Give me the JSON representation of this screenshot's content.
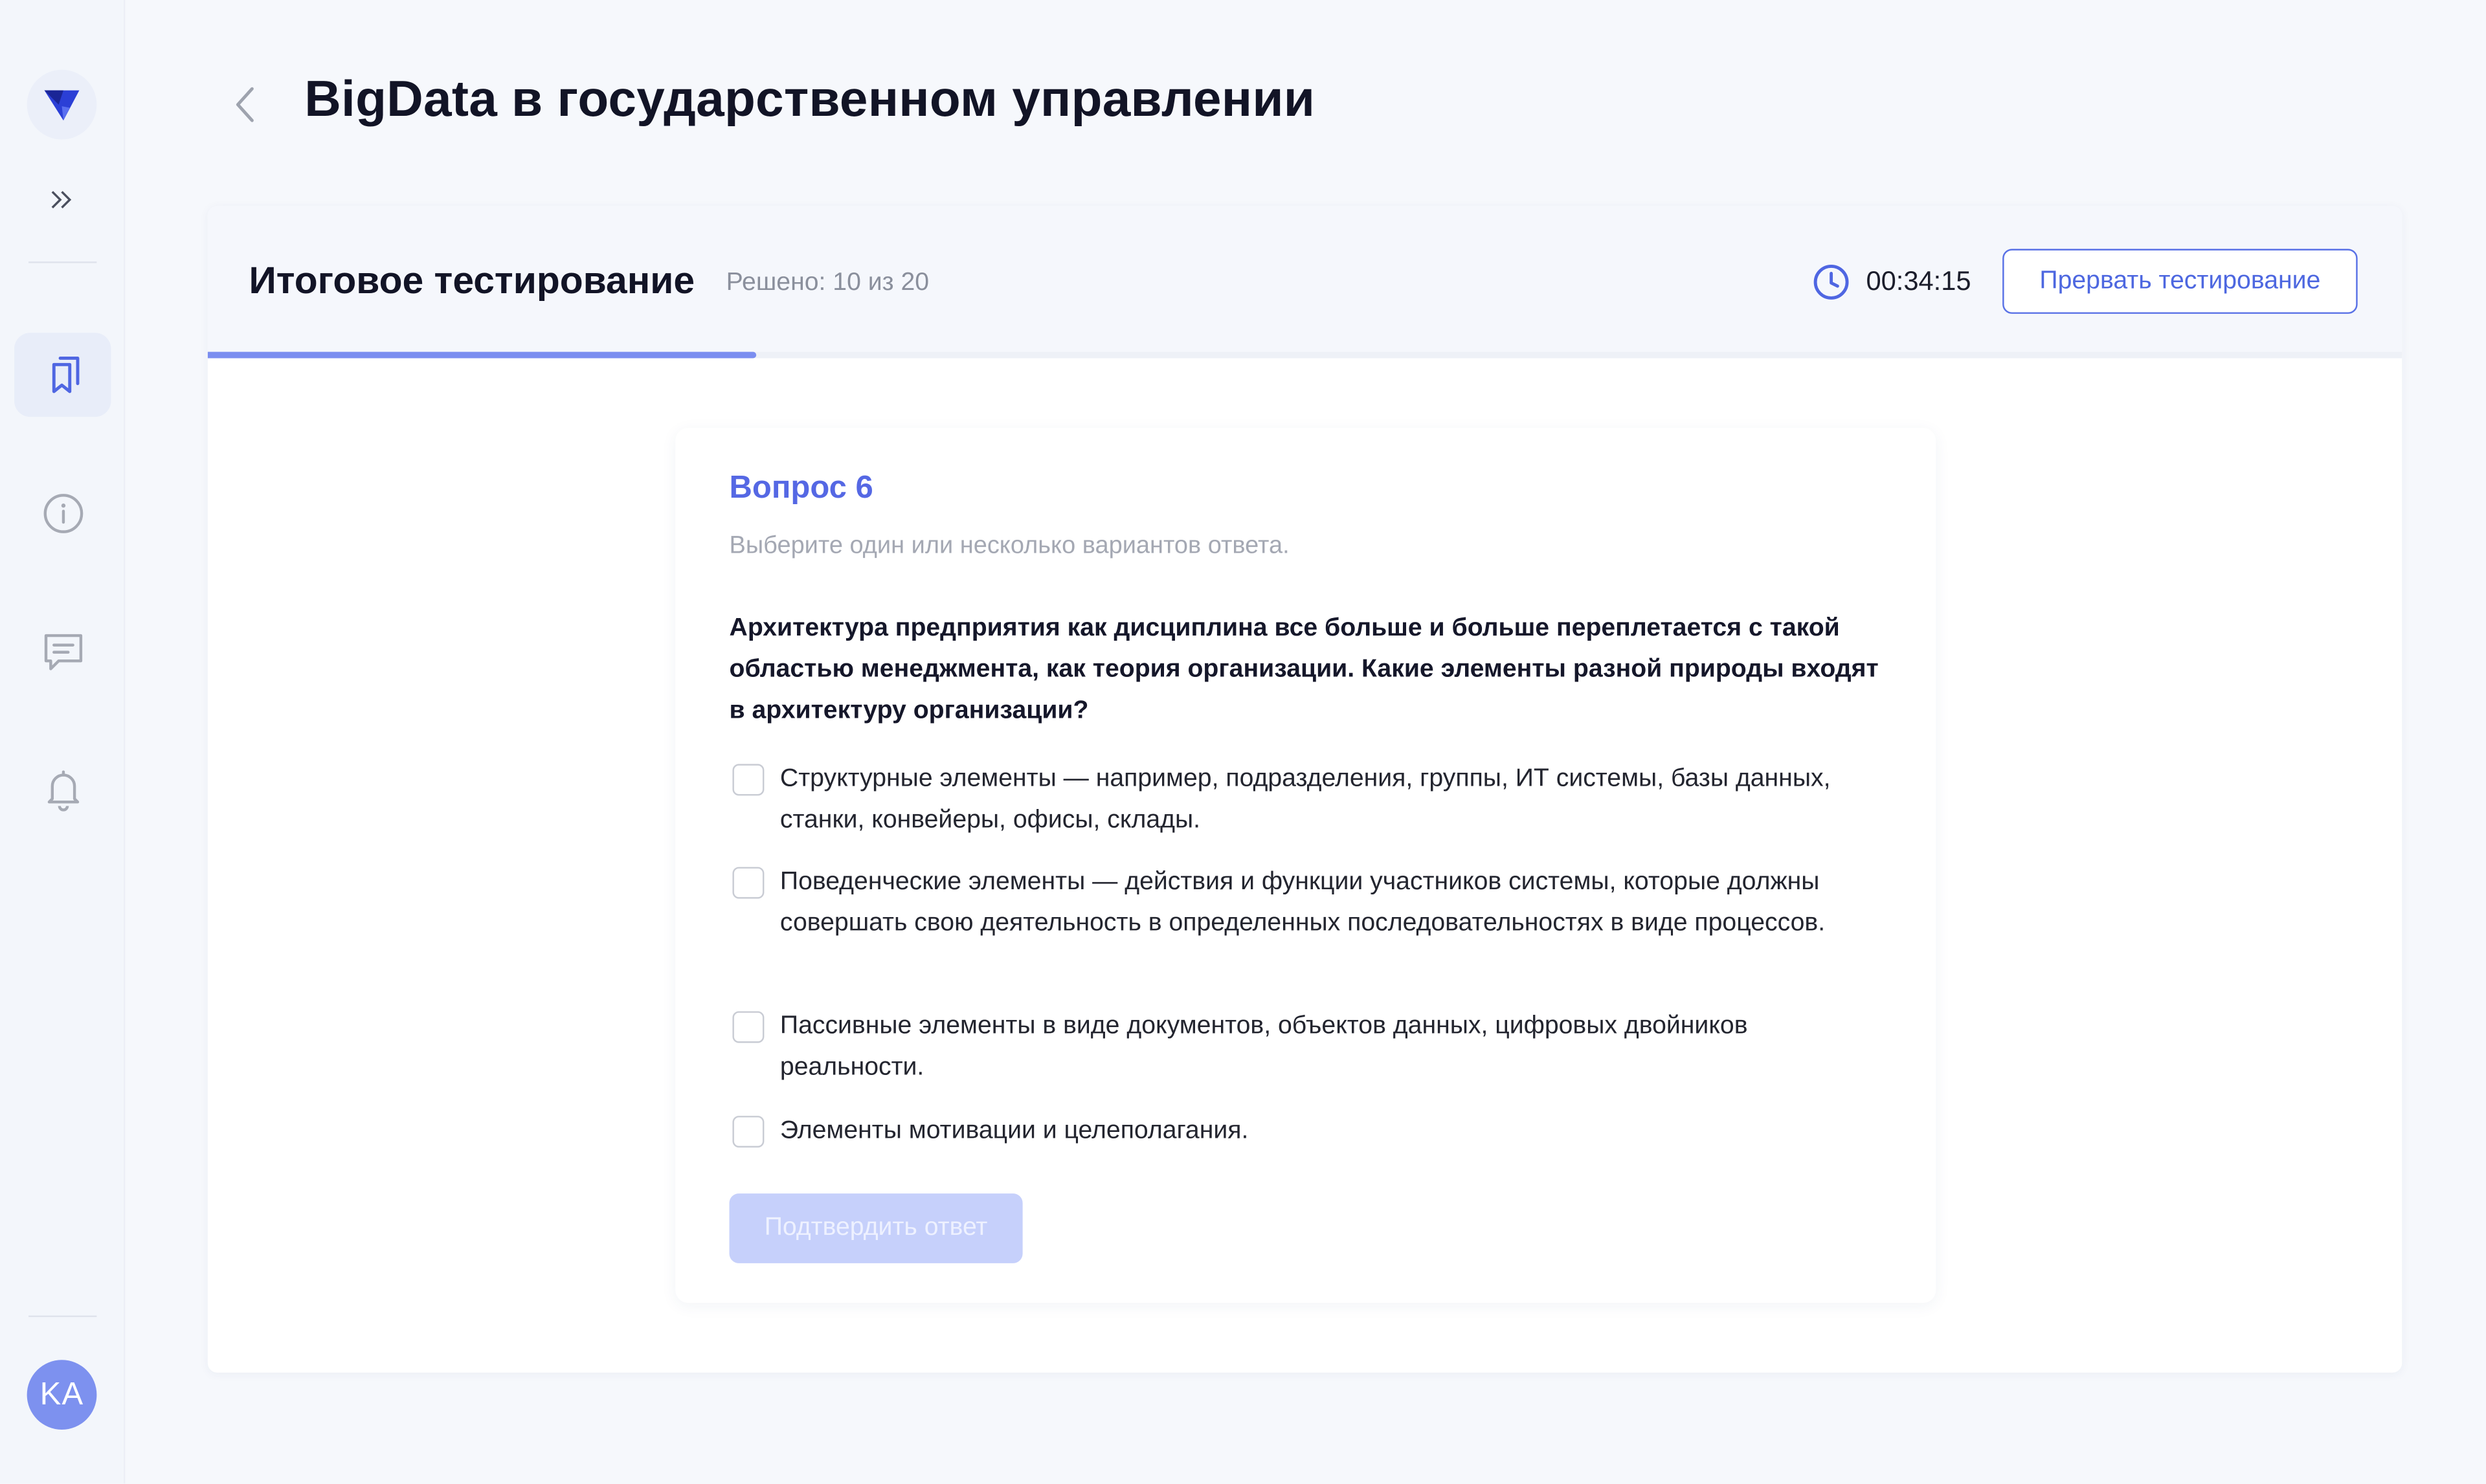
{
  "header": {
    "title": "BigData в государственном управлении"
  },
  "sidebar": {
    "avatar_initials": "KA",
    "nav": [
      {
        "name": "courses",
        "icon": "bookmarks-icon",
        "active": true
      },
      {
        "name": "info",
        "icon": "info-icon",
        "active": false
      },
      {
        "name": "messages",
        "icon": "chat-icon",
        "active": false
      },
      {
        "name": "notifications",
        "icon": "bell-icon",
        "active": false
      }
    ]
  },
  "test": {
    "title": "Итоговое тестирование",
    "solved": "Решено: 10 из 20",
    "progress": 0.25,
    "timer": "00:34:15",
    "abort_label": "Прервать тестирование"
  },
  "question": {
    "number": "Вопрос 6",
    "hint": "Выберите один или несколько вариантов ответа.",
    "text": "Архитектура предприятия как дисциплина все больше и больше переплетается с такой областью менеджмента, как теория организации. Какие элементы разной природы входят в архитектуру организации?",
    "options": [
      {
        "label": "Структурные элементы — например, подразделения, группы, ИТ системы, базы данных, станки, конвейеры, офисы, склады.",
        "checked": false
      },
      {
        "label": "Поведенческие элементы — действия и функции участников системы, которые должны совершать свою деятельность в  определенных последовательностях в  виде процессов.",
        "checked": false
      },
      {
        "label": "Пассивные элементы в виде документов, объектов данных, цифровых двойников реальности.",
        "checked": false
      },
      {
        "label": "Элементы мотивации и  целеполагания.",
        "checked": false
      }
    ],
    "confirm_label": "Подтвердить ответ"
  },
  "colors": {
    "accent": "#5568e4",
    "progress": "#7b8ef0",
    "confirm_disabled": "#c6d0fb"
  }
}
